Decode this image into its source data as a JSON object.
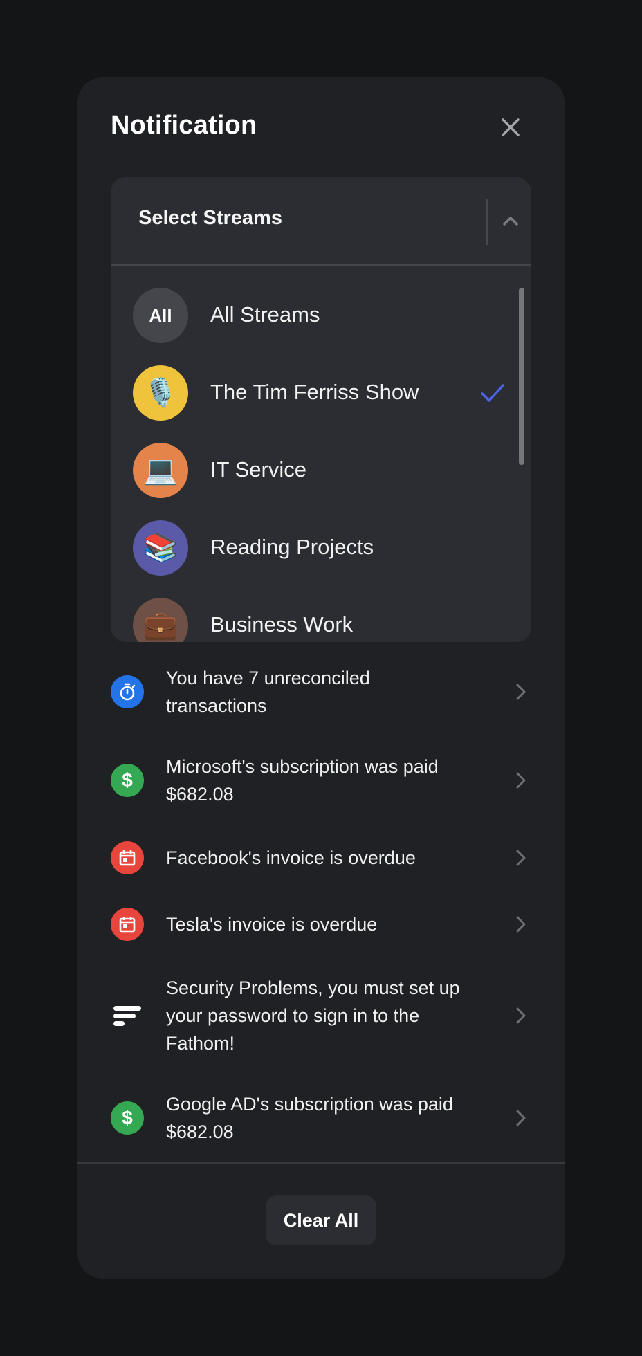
{
  "header": {
    "title": "Notification",
    "close_icon": "close-icon"
  },
  "stream_selector": {
    "label": "Select Streams",
    "toggle_icon": "chevron-up-icon",
    "expanded": true,
    "streams": [
      {
        "name": "All Streams",
        "avatar_text": "All",
        "avatar_color": "#45464b",
        "selected": false
      },
      {
        "name": "The Tim Ferriss Show",
        "avatar_emoji": "🎙️",
        "avatar_color": "#f0c33c",
        "selected": true
      },
      {
        "name": "IT Service",
        "avatar_emoji": "💻",
        "avatar_color": "#e4834a",
        "selected": false
      },
      {
        "name": "Reading Projects",
        "avatar_emoji": "📚",
        "avatar_color": "#5a5aa8",
        "selected": false
      },
      {
        "name": "Business Work",
        "avatar_emoji": "💼",
        "avatar_color": "#6e5046",
        "selected": false
      }
    ],
    "check_color": "#4a63e8"
  },
  "notifications": [
    {
      "icon": "stopwatch-icon",
      "icon_color": "#2374e8",
      "lines": [
        "You have 7 unreconciled",
        "transactions"
      ]
    },
    {
      "icon": "dollar-icon",
      "icon_color": "#34a853",
      "lines": [
        "Microsoft's subscription was paid",
        "$682.08"
      ]
    },
    {
      "icon": "calendar-icon",
      "icon_color": "#e8453c",
      "lines": [
        "Facebook's invoice is overdue"
      ]
    },
    {
      "icon": "calendar-icon",
      "icon_color": "#e8453c",
      "lines": [
        "Tesla's invoice is overdue"
      ]
    },
    {
      "icon": "fathom-logo-icon",
      "icon_color": "#ffffff",
      "lines": [
        "Security Problems, you must set up",
        "your password to sign in to the",
        "Fathom!"
      ]
    },
    {
      "icon": "dollar-icon",
      "icon_color": "#34a853",
      "lines": [
        "Google AD's subscription was paid",
        "$682.08"
      ]
    }
  ],
  "footer": {
    "clear_all_label": "Clear All"
  }
}
